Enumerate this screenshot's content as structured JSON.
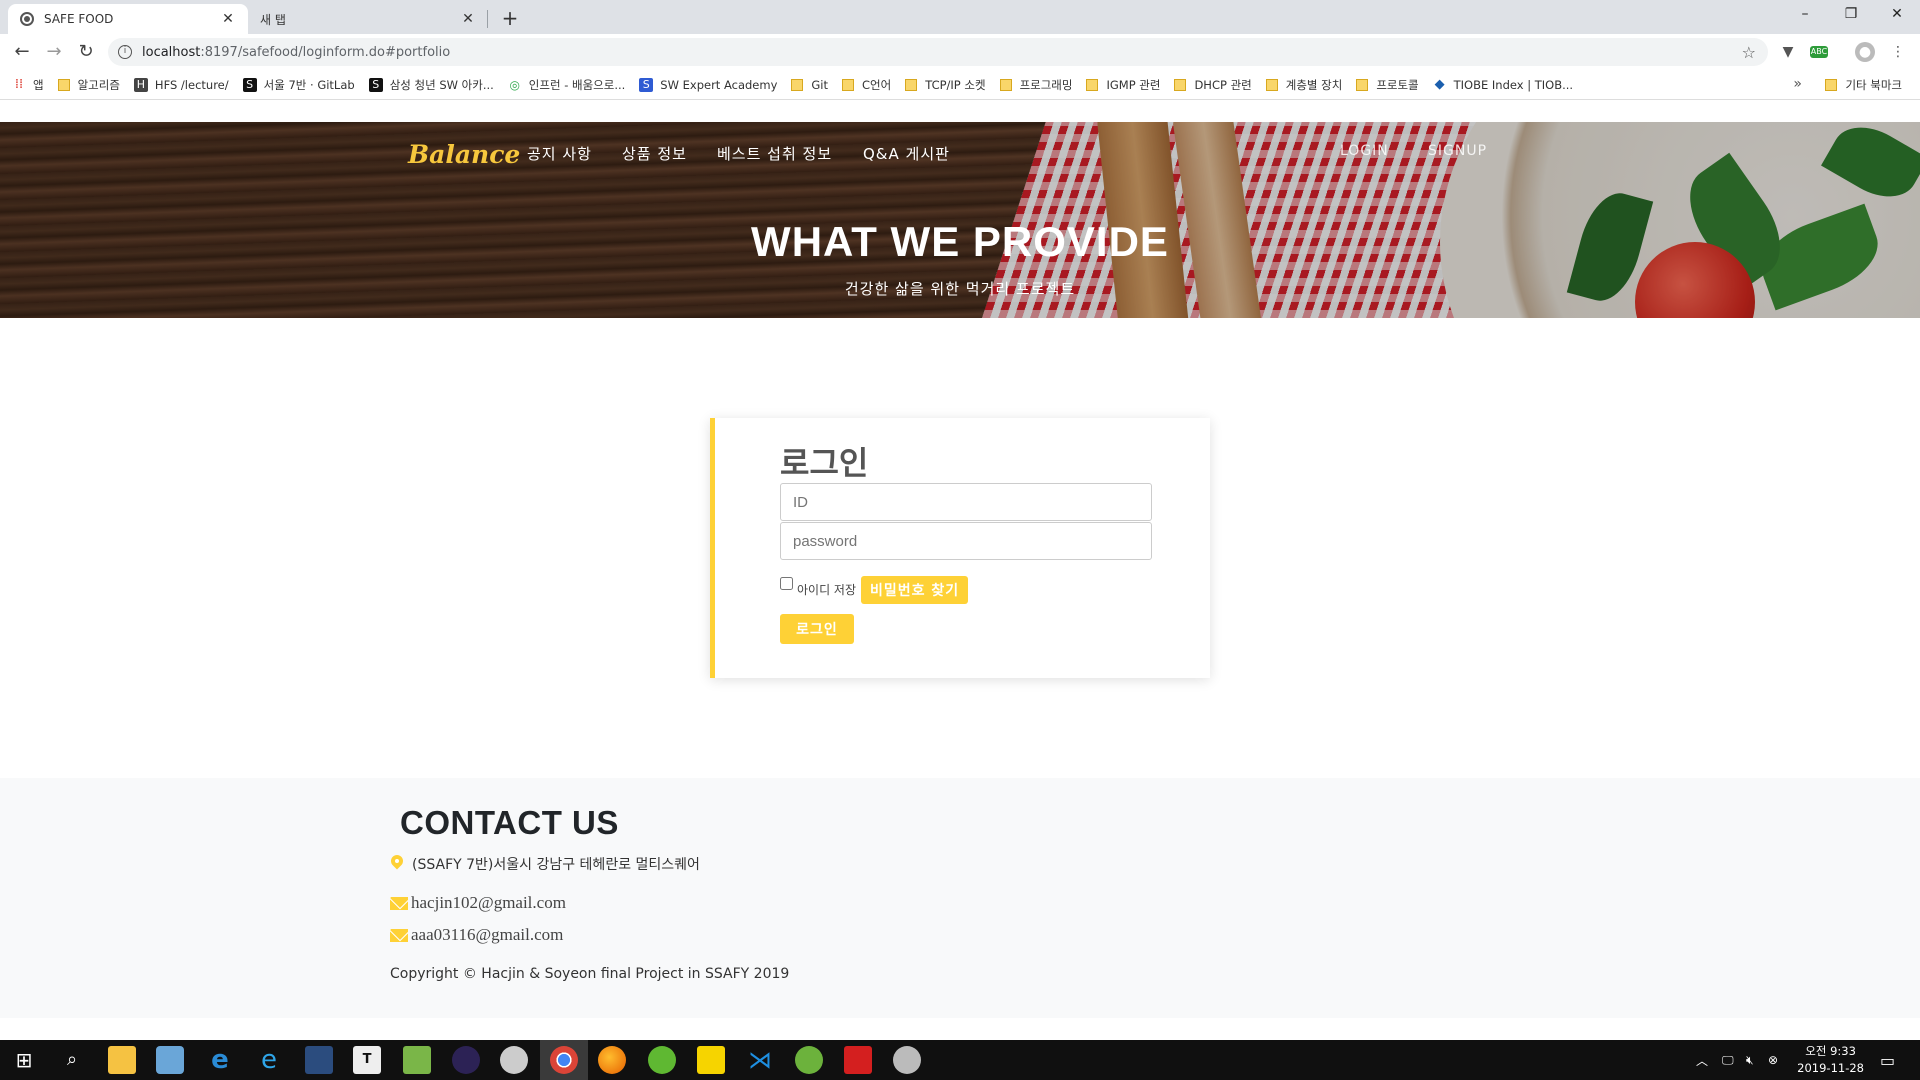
{
  "browser": {
    "tabs": [
      {
        "title": "SAFE FOOD",
        "active": true
      },
      {
        "title": "새 탭",
        "active": false
      }
    ],
    "url_host": "localhost",
    "url_path": ":8197/safefood/loginform.do#portfolio",
    "window_controls": {
      "minimize": "–",
      "restore": "❐",
      "close": "✕"
    }
  },
  "bookmarks": [
    {
      "label": "앱",
      "icon": "apps-grid-icon"
    },
    {
      "label": "알고리즘",
      "icon": "folder-icon"
    },
    {
      "label": "HFS /lecture/",
      "icon": "hfs-icon"
    },
    {
      "label": "서울 7반 · GitLab",
      "icon": "gitlab-icon"
    },
    {
      "label": "삼성 청년 SW 아카...",
      "icon": "ssafy-icon"
    },
    {
      "label": "인프런 - 배움으로...",
      "icon": "inflearn-icon"
    },
    {
      "label": "SW Expert Academy",
      "icon": "swea-icon"
    },
    {
      "label": "Git",
      "icon": "folder-icon"
    },
    {
      "label": "C언어",
      "icon": "folder-icon"
    },
    {
      "label": "TCP/IP 소켓",
      "icon": "folder-icon"
    },
    {
      "label": "프로그래밍",
      "icon": "folder-icon"
    },
    {
      "label": "IGMP 관련",
      "icon": "folder-icon"
    },
    {
      "label": "DHCP 관련",
      "icon": "folder-icon"
    },
    {
      "label": "계층별 장치",
      "icon": "folder-icon"
    },
    {
      "label": "프로토콜",
      "icon": "folder-icon"
    },
    {
      "label": "TIOBE Index | TIOB...",
      "icon": "tiobe-icon"
    }
  ],
  "bookmarks_other": "기타 북마크",
  "nav": {
    "brand": "Balance",
    "links": [
      "공지 사항",
      "상품 정보",
      "베스트 섭취 정보",
      "Q&A 게시판"
    ],
    "login": "LOGIN",
    "signup": "SIGNUP"
  },
  "hero": {
    "title": "WHAT WE PROVIDE",
    "subtitle": "건강한 삶을 위한 먹거리 프로젝트"
  },
  "login": {
    "title": "로그인",
    "id_placeholder": "ID",
    "password_placeholder": "password",
    "remember_label": "아이디 저장",
    "find_password_button": "비밀번호 찾기",
    "login_button": "로그인"
  },
  "footer": {
    "title": "CONTACT US",
    "address": "(SSAFY 7반)서울시 강남구 테헤란로 멀티스퀘어",
    "emails": [
      "hacjin102@gmail.com",
      "aaa03116@gmail.com"
    ],
    "copyright": "Copyright © Hacjin & Soyeon final Project in SSAFY 2019"
  },
  "taskbar": {
    "clock_period_time": "오전 9:33",
    "date": "2019-11-28"
  },
  "colors": {
    "accent": "#fed136",
    "brand": "#f7c73d",
    "footer_bg": "#f8f9fa"
  }
}
